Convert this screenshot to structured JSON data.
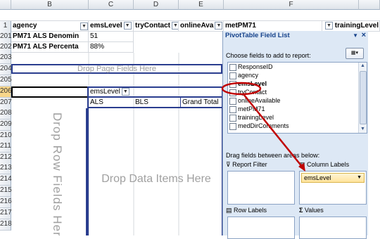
{
  "columns": [
    "B",
    "C",
    "D",
    "E",
    "F"
  ],
  "row_numbers": [
    "1",
    "201",
    "202",
    "203",
    "204",
    "205",
    "206",
    "207",
    "208",
    "209",
    "210",
    "211",
    "212",
    "213",
    "214",
    "215",
    "216",
    "217",
    "218"
  ],
  "header_row": {
    "agency": "agency",
    "emsLevel": "emsLevel",
    "tryContact": "tryContact",
    "onlineAvailable": "onlineAva",
    "metPM71": "metPM71",
    "trainingLevel": "trainingLevel"
  },
  "rows": {
    "r201": {
      "label": "PM71 ALS Denomin",
      "value": "51"
    },
    "r202": {
      "label": "PM71 ALS Percenta",
      "value": "88%"
    }
  },
  "pivot": {
    "drop_page_fields": "Drop Page Fields Here",
    "col_field": "emsLevel",
    "col_items": [
      "ALS",
      "BLS",
      "Grand Total"
    ],
    "drop_row_fields": "Drop Row Fields Here",
    "drop_data_items": "Drop Data Items Here"
  },
  "field_list": {
    "title": "PivotTable Field List",
    "choose_label": "Choose fields to add to report:",
    "fields": [
      "ResponseID",
      "agency",
      "emsLevel",
      "tryContact",
      "onlineAvailable",
      "metPM71",
      "trainingLevel",
      "medDirComments"
    ],
    "drag_label": "Drag fields between areas below:",
    "report_filter": "Report Filter",
    "column_labels": "Column Labels",
    "column_item": "emsLevel",
    "row_labels": "Row Labels",
    "values": "Values"
  },
  "colors": {
    "accent_border": "#2a3d8f",
    "annotation": "#c00000",
    "pane": "#dde8f5"
  }
}
